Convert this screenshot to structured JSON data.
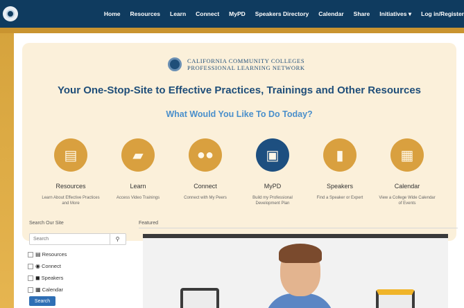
{
  "nav": {
    "items": [
      "Home",
      "Resources",
      "Learn",
      "Connect",
      "MyPD",
      "Speakers Directory",
      "Calendar",
      "Share",
      "Initiatives ▾",
      "Log in/Register"
    ]
  },
  "brand": {
    "line1": "CALIFORNIA COMMUNITY COLLEGES",
    "line2": "PROFESSIONAL LEARNING NETWORK"
  },
  "hero": {
    "headline": "Your One-Stop-Site to Effective Practices, Trainings and Other Resources",
    "subhead": "What Would You Like To Do Today?"
  },
  "tiles": [
    {
      "icon": "book-icon",
      "glyph": "▤",
      "label": "Resources",
      "desc": "Learn About Effective Practices and More",
      "active": false
    },
    {
      "icon": "graduation-cap-icon",
      "glyph": "▰",
      "label": "Learn",
      "desc": "Access Video Trainings",
      "active": false
    },
    {
      "icon": "people-icon",
      "glyph": "●●",
      "label": "Connect",
      "desc": "Connect with My Peers",
      "active": false
    },
    {
      "icon": "briefcase-icon",
      "glyph": "▣",
      "label": "MyPD",
      "desc": "Build my Professional Development Plan",
      "active": true
    },
    {
      "icon": "microphone-icon",
      "glyph": "▮",
      "label": "Speakers",
      "desc": "Find a Speaker or Expert",
      "active": false
    },
    {
      "icon": "calendar-icon",
      "glyph": "▦",
      "label": "Calendar",
      "desc": "View a College Wide Calendar of Events",
      "active": false
    }
  ],
  "search": {
    "label": "Search Our Site",
    "placeholder": "Search",
    "icon_glyph": "⚲",
    "options": [
      {
        "icon": "▤",
        "label": "Resources"
      },
      {
        "icon": "◉",
        "label": "Connect"
      },
      {
        "icon": "◼",
        "label": "Speakers"
      },
      {
        "icon": "▦",
        "label": "Calendar"
      }
    ],
    "button": "Search"
  },
  "featured": {
    "label": "Featured"
  },
  "colors": {
    "navy": "#0f3b5f",
    "gold": "#d9a03f",
    "active_tile": "#1d4f80",
    "hero_bg": "#fbf0da",
    "subhead_blue": "#4a8fcb"
  }
}
